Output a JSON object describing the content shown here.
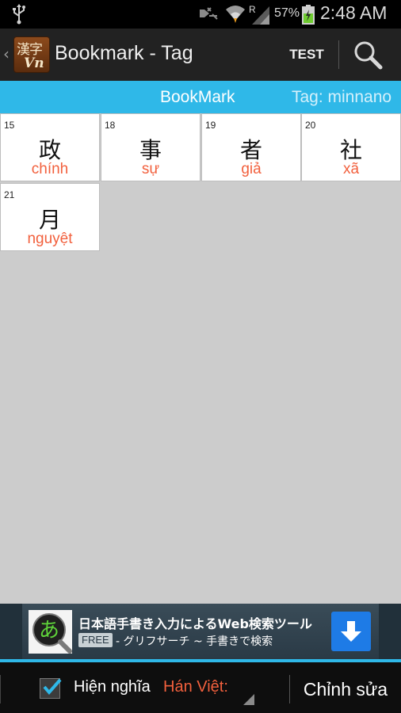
{
  "status_bar": {
    "battery_percent": "57%",
    "time": "2:48 AM",
    "icons": [
      "usb-icon",
      "mute-icon",
      "wifi-icon",
      "signal-roaming-icon",
      "battery-charging-icon"
    ],
    "roaming_letter": "R"
  },
  "action_bar": {
    "logo_kanji": "漢字",
    "logo_sub": "Vn",
    "title": "Bookmark - Tag",
    "test_label": "TEST",
    "icons": [
      "back-chevron-icon",
      "search-icon"
    ]
  },
  "tabs": {
    "bookmark": "BookMark",
    "tag": "Tag: minnano"
  },
  "cards": [
    {
      "num": "15",
      "kanji": "政",
      "reading": "chính"
    },
    {
      "num": "18",
      "kanji": "事",
      "reading": "sự"
    },
    {
      "num": "19",
      "kanji": "者",
      "reading": "giả"
    },
    {
      "num": "20",
      "kanji": "社",
      "reading": "xã"
    },
    {
      "num": "21",
      "kanji": "月",
      "reading": "nguyệt"
    }
  ],
  "ad": {
    "icon_char": "あ",
    "title": "日本語手書き入力によるWeb検索ツール",
    "free_badge": "FREE",
    "subtitle": "- グリフサーチ ~ 手書きで検索",
    "icons": [
      "handwriting-search-icon",
      "download-icon"
    ]
  },
  "bottom_bar": {
    "checkbox_checked": true,
    "label": "Hiện nghĩa",
    "select_value": "Hán Việt:",
    "edit_label": "Chỉnh sửa"
  },
  "colors": {
    "accent_blue": "#2fb8e8",
    "reading_orange": "#f2603d",
    "action_bar": "#222222",
    "background": "#cccccc"
  }
}
